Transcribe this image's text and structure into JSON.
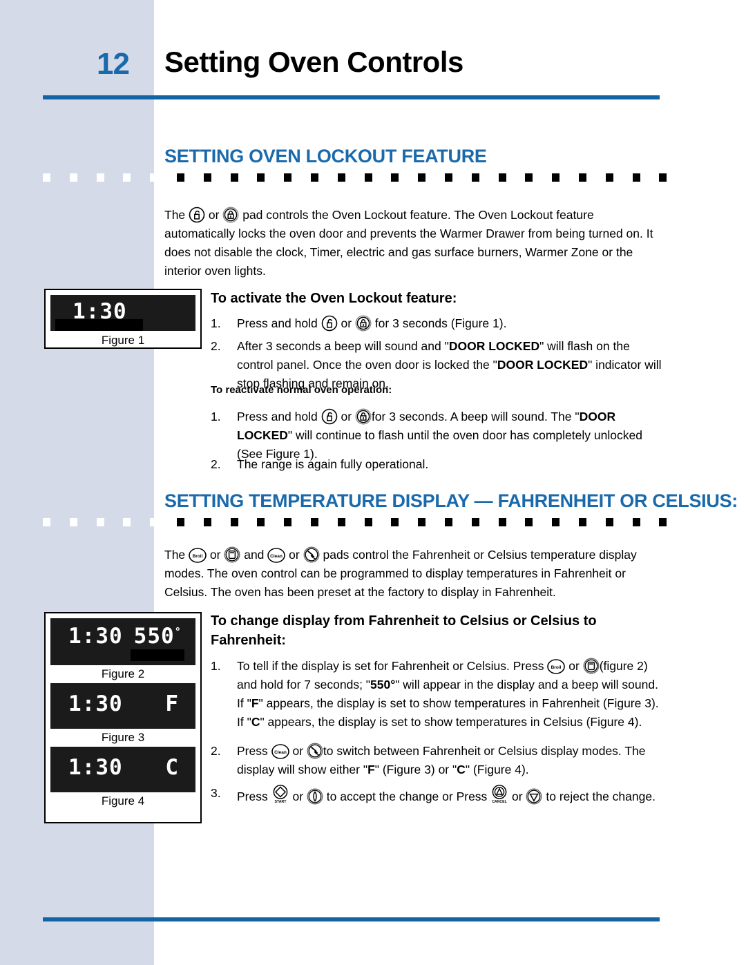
{
  "page": {
    "number": "12",
    "title": "Setting Oven Controls",
    "accent_blue": "#1a6aab",
    "rule_blue": "#1364a5",
    "sidebar_color": "#d5dae9"
  },
  "sections": [
    {
      "heading": "SETTING OVEN LOCKOUT FEATURE",
      "intro_parts": {
        "p1": "The",
        "p2": "or",
        "p3": "pad controls the Oven Lockout feature. The Oven Lockout feature automatically locks the oven door and prevents the Warmer Drawer from being turned on. It does not disable the clock, Timer, electric and gas  surface burners, Warmer Zone or the interior oven lights."
      },
      "sub_heading": "To activate the Oven Lockout feature:",
      "steps": [
        {
          "num": "1.",
          "a": "Press and hold",
          "b": "or",
          "c": "for 3 seconds (Figure 1)."
        },
        {
          "num": "2.",
          "text_a": "After 3 seconds a beep will sound and \"",
          "bold_a": "DOOR LOCKED",
          "text_b": "\" will flash on the control panel. Once the oven door is locked the \"",
          "bold_b": "DOOR LOCKED",
          "text_c": "\" indicator will stop flashing and remain on."
        }
      ],
      "mini_heading": "To reactivate normal oven operation:",
      "steps2": [
        {
          "num": "1.",
          "a": "Press and hold",
          "b": "or",
          "c": "for 3 seconds. A beep will sound. The  \"",
          "bold_a": "DOOR LOCKED",
          "d": "\" will continue to flash until the oven door has completely unlocked (See Figure 1)."
        },
        {
          "num": "2.",
          "a": "The range is again fully operational."
        }
      ]
    },
    {
      "heading": "SETTING TEMPERATURE DISPLAY — FAHRENHEIT OR CELSIUS:",
      "intro_parts": {
        "p1": "The",
        "p2": "or",
        "p3": "and",
        "p4": "or",
        "p5": "pads control the Fahrenheit or Celsius temperature display modes. The oven control can be programmed to display temperatures in Fahrenheit or Celsius.  The oven has been preset at the factory to display in Fahrenheit."
      },
      "sub_heading": "To change display from Fahrenheit to Celsius or Celsius to Fahrenheit:",
      "steps": [
        {
          "num": "1.",
          "a": "To tell if the display is set for Fahrenheit or Celsius. Press",
          "b": "or",
          "c": "(figure 2) and hold for 7 seconds; \"",
          "bold_a": "550°",
          "d": "\" will appear in the display and a beep will sound.  If \"",
          "bold_b": "F",
          "e": "\" appears, the display is set to show temperatures in Fahrenheit (Figure 3).  If \"",
          "bold_c": "C",
          "f": "\" appears, the display is set to show temperatures in Celsius (Figure 4)."
        },
        {
          "num": "2.",
          "a": "Press",
          "b": "or",
          "c": "to switch between Fahrenheit or Celsius display modes. The display will show either \"",
          "bold_a": "F",
          "d": "\" (Figure 3) or \"",
          "bold_b": "C",
          "e": "\" (Figure 4)."
        },
        {
          "num": "3.",
          "a": "Press",
          "b": "or",
          "c": "to accept the change or Press",
          "d": "or",
          "e": "to reject the change."
        }
      ]
    }
  ],
  "figures": [
    {
      "caption": "Figure 1",
      "display_time": "1:30",
      "display_temp": "",
      "display_mode": ""
    },
    {
      "caption": "Figure 2",
      "display_time": "1:30",
      "display_temp": "550",
      "degree": "°",
      "display_mode": ""
    },
    {
      "caption": "Figure 3",
      "display_time": "1:30",
      "display_mode": "F"
    },
    {
      "caption": "Figure 4",
      "display_time": "1:30",
      "display_mode": "C"
    }
  ],
  "icons": {
    "lock_open": "padlock-open-icon",
    "lock_closed": "padlock-closed-icon",
    "broil_text": "Broil",
    "broil_symbol": "broil-element-icon",
    "clean_text": "Clean",
    "clean_symbol": "self-clean-brush-icon",
    "start_text": "START",
    "start_symbol": "start-diamond-icon",
    "cancel_text": "CANCEL",
    "cancel_symbol": "cancel-triangle-icon"
  }
}
